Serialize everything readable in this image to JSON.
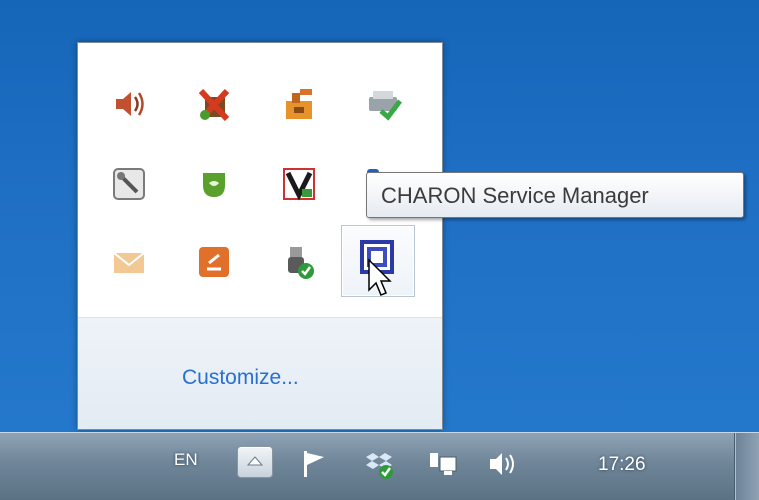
{
  "tray_popup": {
    "icons": [
      {
        "name": "speaker-icon"
      },
      {
        "name": "network-red-x-icon"
      },
      {
        "name": "orange-network-icon"
      },
      {
        "name": "printer-check-icon"
      },
      {
        "name": "tool-icon"
      },
      {
        "name": "green-app-icon"
      },
      {
        "name": "v-app-icon"
      },
      {
        "name": "blue-app-icon"
      },
      {
        "name": "mail-icon"
      },
      {
        "name": "orange-app-icon"
      },
      {
        "name": "usb-check-icon"
      },
      {
        "name": "charon-icon"
      }
    ],
    "customize_label": "Customize..."
  },
  "tooltip": {
    "text": "CHARON Service Manager"
  },
  "taskbar": {
    "language": "EN",
    "clock": "17:26"
  },
  "colors": {
    "desktop": "#1e6fc4",
    "link": "#2a6fd0",
    "taskbar": "#6f8598"
  }
}
